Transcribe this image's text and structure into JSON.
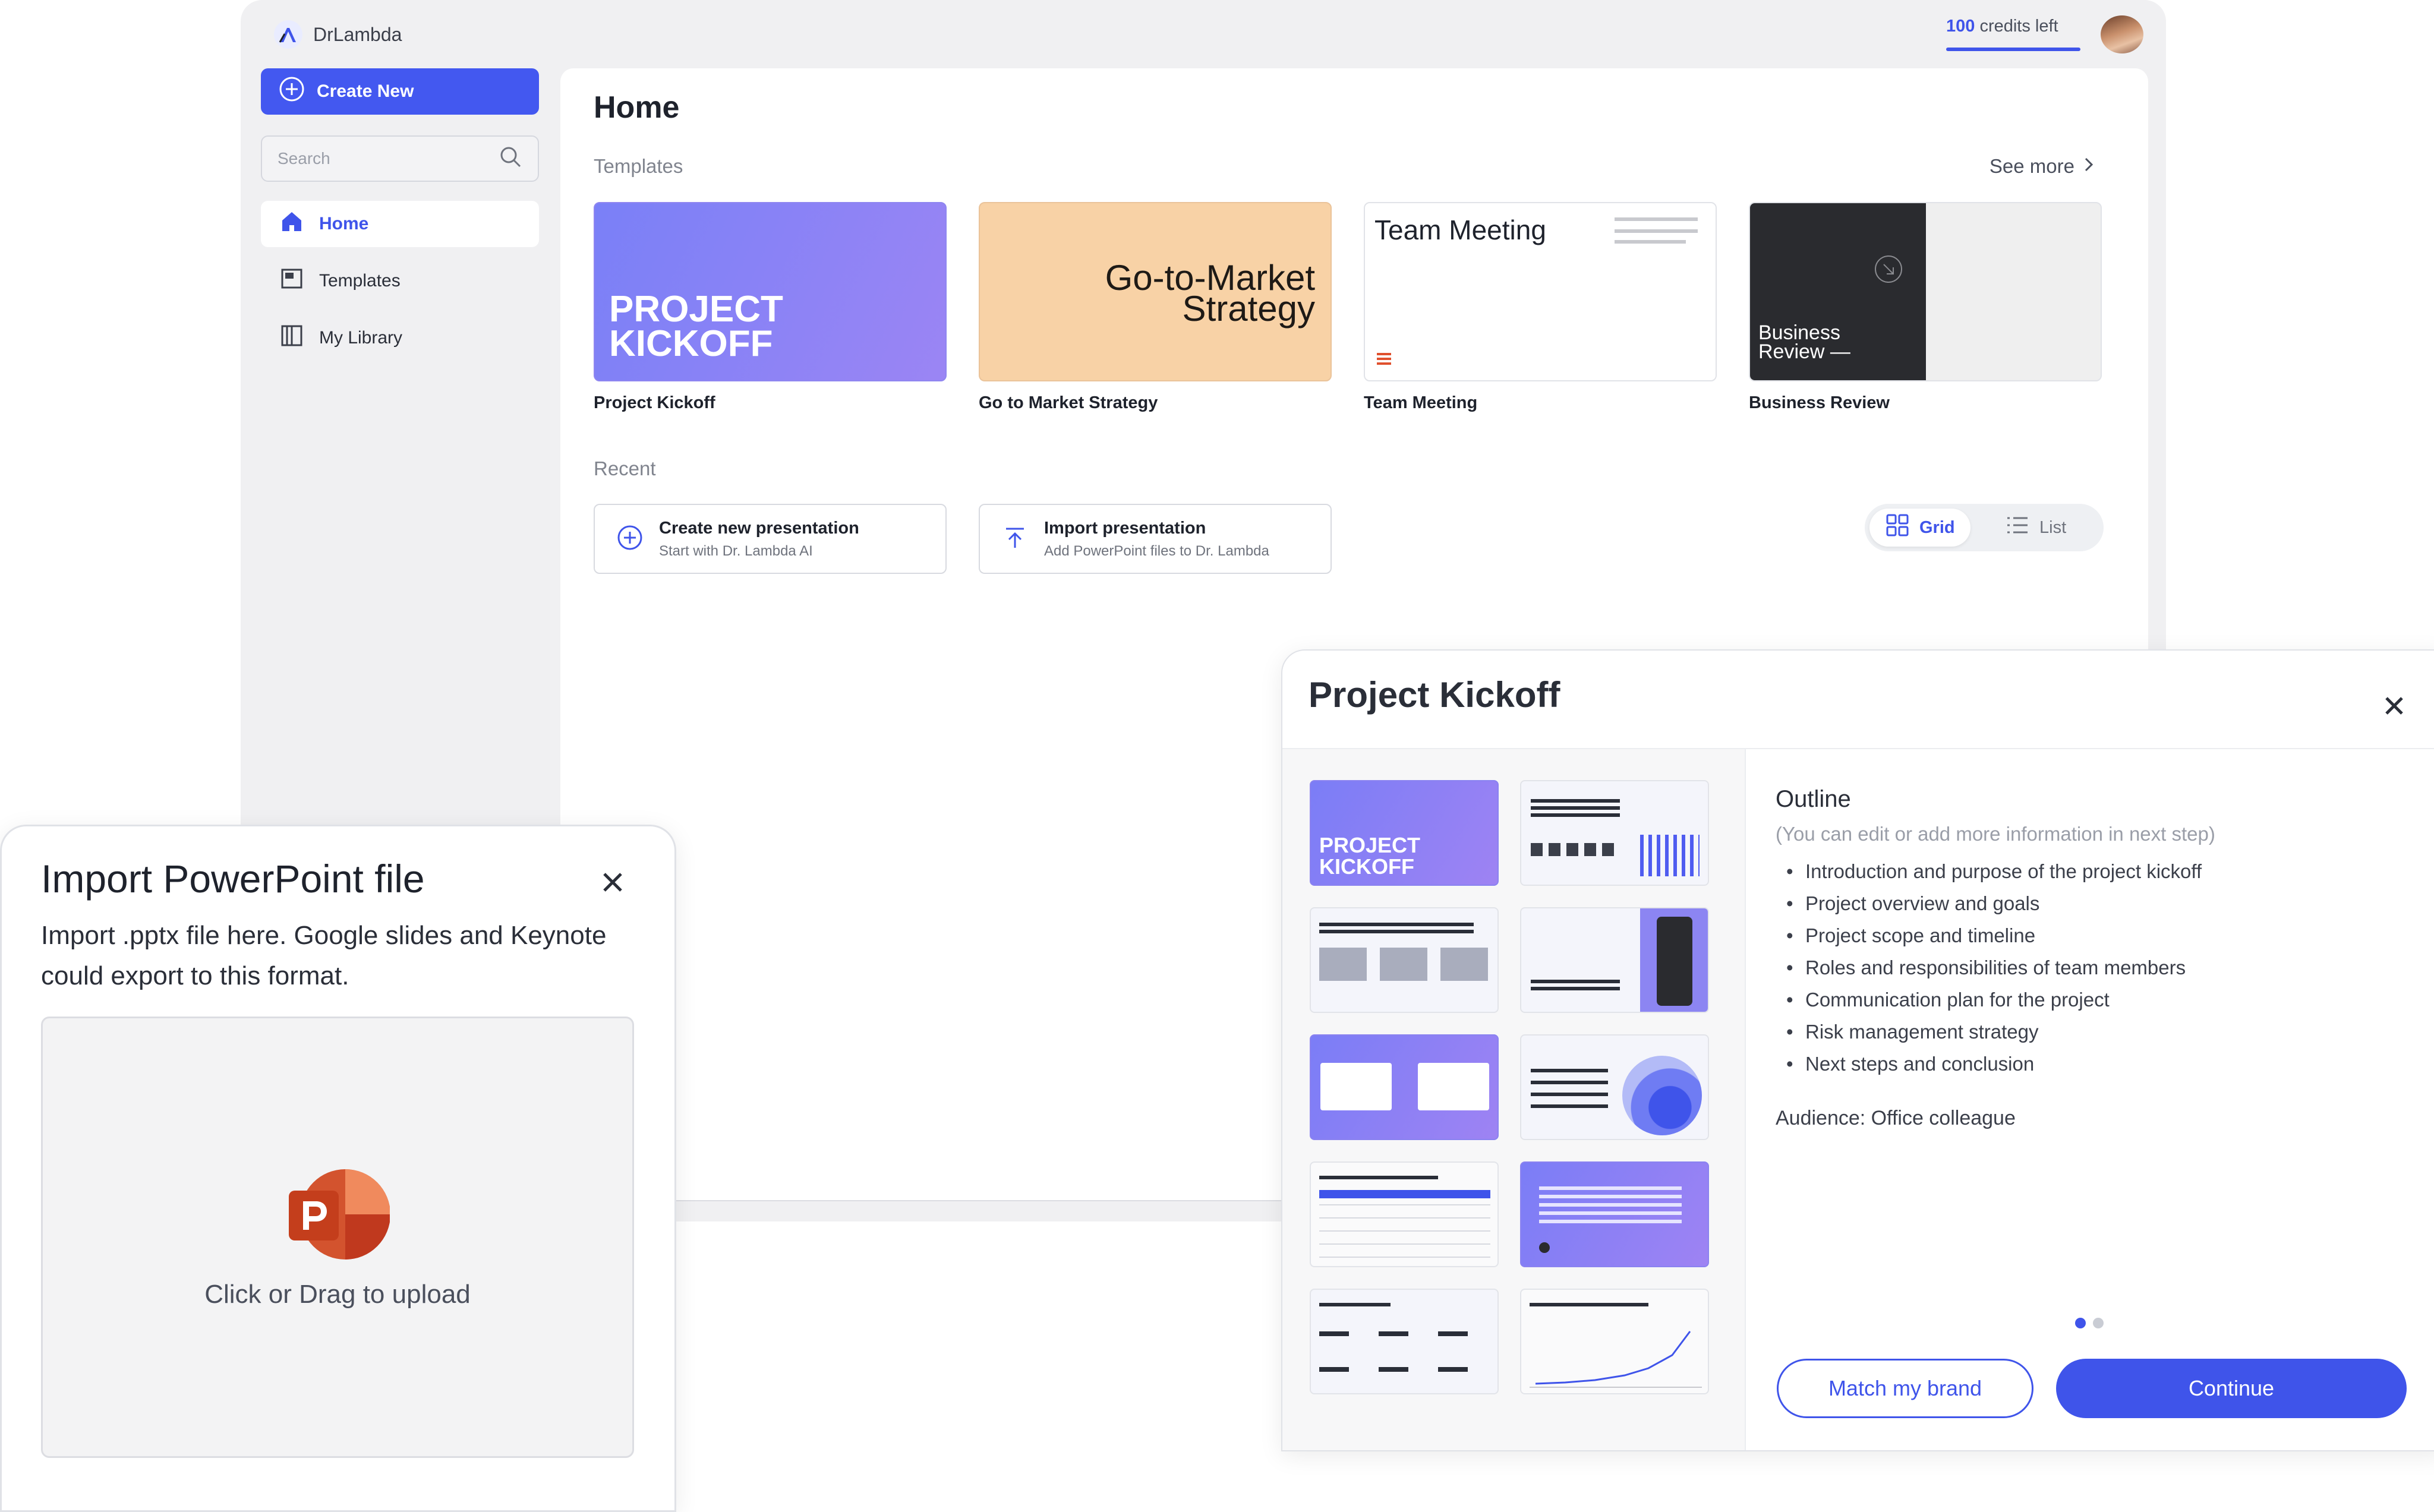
{
  "app": {
    "name": "DrLambda",
    "credits_count": "100",
    "credits_suffix": " credits left"
  },
  "sidebar": {
    "create_label": "Create New",
    "search_placeholder": "Search",
    "items": [
      {
        "label": "Home",
        "icon": "home-icon",
        "active": true
      },
      {
        "label": "Templates",
        "icon": "templates-icon",
        "active": false
      },
      {
        "label": "My Library",
        "icon": "library-icon",
        "active": false
      }
    ]
  },
  "home": {
    "title": "Home",
    "templates_label": "Templates",
    "see_more": "See more",
    "templates": [
      {
        "name": "Project Kickoff",
        "thumb_text": "PROJECT KICKOFF"
      },
      {
        "name": "Go to Market Strategy",
        "thumb_text": "Go-to-Market Strategy"
      },
      {
        "name": "Team Meeting",
        "thumb_text": "Team Meeting"
      },
      {
        "name": "Business Review",
        "thumb_text": "Business Review —"
      }
    ],
    "recent_label": "Recent",
    "actions": [
      {
        "title": "Create new presentation",
        "subtitle": "Start with Dr. Lambda AI",
        "icon": "plus-circle-icon"
      },
      {
        "title": "Import presentation",
        "subtitle": "Add PowerPoint files to Dr. Lambda",
        "icon": "upload-icon"
      }
    ],
    "view_toggle": {
      "grid": "Grid",
      "list": "List",
      "selected": "Grid"
    }
  },
  "import_modal": {
    "title": "Import PowerPoint file",
    "description": "Import .pptx file here. Google slides and Keynote could export to this format.",
    "drop_text": "Click or Drag to upload",
    "icon": "powerpoint-icon"
  },
  "template_modal": {
    "title": "Project Kickoff",
    "outline_heading": "Outline",
    "outline_hint": "(You can edit or add more information in next step)",
    "outline_items": [
      "Introduction and purpose of the project kickoff",
      "Project overview and goals",
      "Project scope and timeline",
      "Roles and responsibilities of team members",
      "Communication plan for the project",
      "Risk management strategy",
      "Next steps and conclusion"
    ],
    "audience": "Audience: Office colleague",
    "match_brand_label": "Match my brand",
    "continue_label": "Continue",
    "first_slide_text": "PROJECT KICKOFF",
    "page_count": 2,
    "current_page": 1
  },
  "colors": {
    "accent": "#3f54ea",
    "sidebar_bg": "#f0f0f2",
    "template_purple": "#8b84f4",
    "template_peach": "#f8d2a6",
    "template_dark": "#2a2b2f"
  }
}
